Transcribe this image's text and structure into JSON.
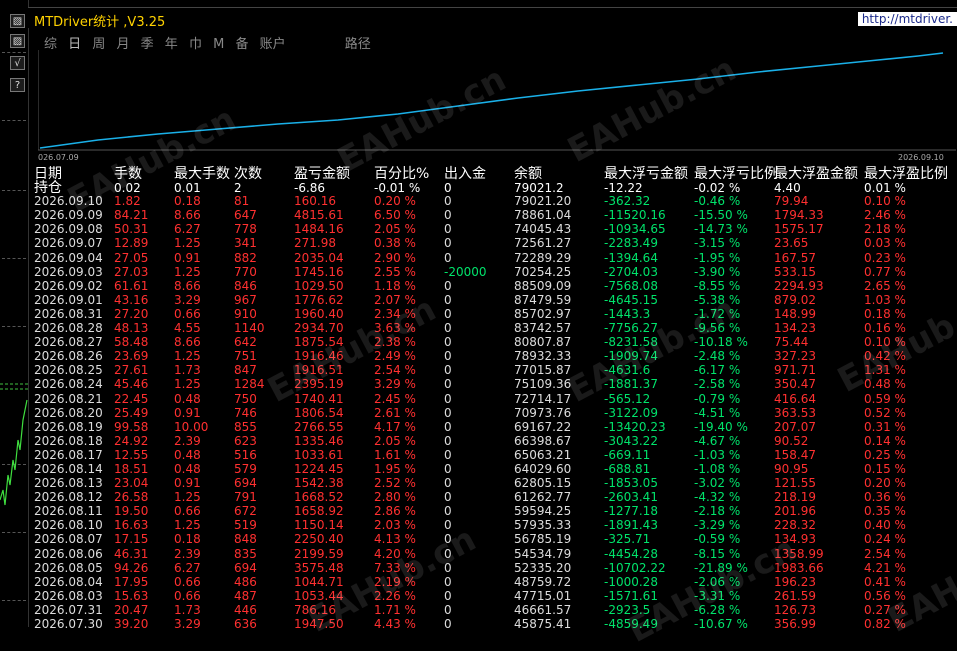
{
  "app": {
    "title": "MTDriver统计 ,V3.25",
    "url": "http://mtdriver."
  },
  "toolbar": [
    "▧",
    "▨",
    "√",
    "?"
  ],
  "tabs": [
    "综",
    "日",
    "周",
    "月",
    "季",
    "年",
    "巾",
    "M",
    "备",
    "账户",
    "路径"
  ],
  "chart": {
    "start_label": "026.07.09",
    "end_label": "2026.09.10",
    "line_color": "#1ab0e8"
  },
  "watermark": "EAHub.cn",
  "columns": [
    "日期",
    "手数",
    "最大手数",
    "次数",
    "盈亏金额",
    "百分比%",
    "出入金",
    "余额",
    "最大浮亏金额",
    "最大浮亏比例",
    "最大浮盈金额",
    "最大浮盈比例"
  ],
  "holding": {
    "date": "持仓",
    "lots": "0.02",
    "max_lots": "0.01",
    "count": "2",
    "pnl": "-6.86",
    "pct": "-0.01 %",
    "flow": "0",
    "balance": "79021.2",
    "max_loss": "-12.22",
    "max_loss_pct": "-0.02 %",
    "max_gain": "4.40",
    "max_gain_pct": "0.01 %"
  },
  "rows": [
    [
      "2026.09.10",
      "1.82",
      "0.18",
      "81",
      "160.16",
      "0.20 %",
      "0",
      "79021.20",
      "-362.32",
      "-0.46 %",
      "79.94",
      "0.10 %"
    ],
    [
      "2026.09.09",
      "84.21",
      "8.66",
      "647",
      "4815.61",
      "6.50 %",
      "0",
      "78861.04",
      "-11520.16",
      "-15.50 %",
      "1794.33",
      "2.46 %"
    ],
    [
      "2026.09.08",
      "50.31",
      "6.27",
      "778",
      "1484.16",
      "2.05 %",
      "0",
      "74045.43",
      "-10934.65",
      "-14.73 %",
      "1575.17",
      "2.18 %"
    ],
    [
      "2026.09.07",
      "12.89",
      "1.25",
      "341",
      "271.98",
      "0.38 %",
      "0",
      "72561.27",
      "-2283.49",
      "-3.15 %",
      "23.65",
      "0.03 %"
    ],
    [
      "2026.09.04",
      "27.05",
      "0.91",
      "882",
      "2035.04",
      "2.90 %",
      "0",
      "72289.29",
      "-1394.64",
      "-1.95 %",
      "167.57",
      "0.23 %"
    ],
    [
      "2026.09.03",
      "27.03",
      "1.25",
      "770",
      "1745.16",
      "2.55 %",
      "-20000",
      "70254.25",
      "-2704.03",
      "-3.90 %",
      "533.15",
      "0.77 %"
    ],
    [
      "2026.09.02",
      "61.61",
      "8.66",
      "846",
      "1029.50",
      "1.18 %",
      "0",
      "88509.09",
      "-7568.08",
      "-8.55 %",
      "2294.93",
      "2.65 %"
    ],
    [
      "2026.09.01",
      "43.16",
      "3.29",
      "967",
      "1776.62",
      "2.07 %",
      "0",
      "87479.59",
      "-4645.15",
      "-5.38 %",
      "879.02",
      "1.03 %"
    ],
    [
      "2026.08.31",
      "27.20",
      "0.66",
      "910",
      "1960.40",
      "2.34 %",
      "0",
      "85702.97",
      "-1443.3",
      "-1.72 %",
      "148.99",
      "0.18 %"
    ],
    [
      "2026.08.28",
      "48.13",
      "4.55",
      "1140",
      "2934.70",
      "3.63 %",
      "0",
      "83742.57",
      "-7756.27",
      "-9.56 %",
      "134.23",
      "0.16 %"
    ],
    [
      "2026.08.27",
      "58.48",
      "8.66",
      "642",
      "1875.54",
      "2.38 %",
      "0",
      "80807.87",
      "-8231.58",
      "-10.18 %",
      "75.44",
      "0.10 %"
    ],
    [
      "2026.08.26",
      "23.69",
      "1.25",
      "751",
      "1916.46",
      "2.49 %",
      "0",
      "78932.33",
      "-1909.74",
      "-2.48 %",
      "327.23",
      "0.42 %"
    ],
    [
      "2026.08.25",
      "27.61",
      "1.73",
      "847",
      "1916.51",
      "2.54 %",
      "0",
      "77015.87",
      "-4631.6",
      "-6.17 %",
      "971.71",
      "1.31 %"
    ],
    [
      "2026.08.24",
      "45.46",
      "1.25",
      "1284",
      "2395.19",
      "3.29 %",
      "0",
      "75109.36",
      "-1881.37",
      "-2.58 %",
      "350.47",
      "0.48 %"
    ],
    [
      "2026.08.21",
      "22.45",
      "0.48",
      "750",
      "1740.41",
      "2.45 %",
      "0",
      "72714.17",
      "-565.12",
      "-0.79 %",
      "416.64",
      "0.59 %"
    ],
    [
      "2026.08.20",
      "25.49",
      "0.91",
      "746",
      "1806.54",
      "2.61 %",
      "0",
      "70973.76",
      "-3122.09",
      "-4.51 %",
      "363.53",
      "0.52 %"
    ],
    [
      "2026.08.19",
      "99.58",
      "10.00",
      "855",
      "2766.55",
      "4.17 %",
      "0",
      "69167.22",
      "-13420.23",
      "-19.40 %",
      "207.07",
      "0.31 %"
    ],
    [
      "2026.08.18",
      "24.92",
      "2.39",
      "623",
      "1335.46",
      "2.05 %",
      "0",
      "66398.67",
      "-3043.22",
      "-4.67 %",
      "90.52",
      "0.14 %"
    ],
    [
      "2026.08.17",
      "12.55",
      "0.48",
      "516",
      "1033.61",
      "1.61 %",
      "0",
      "65063.21",
      "-669.11",
      "-1.03 %",
      "158.47",
      "0.25 %"
    ],
    [
      "2026.08.14",
      "18.51",
      "0.48",
      "579",
      "1224.45",
      "1.95 %",
      "0",
      "64029.60",
      "-688.81",
      "-1.08 %",
      "90.95",
      "0.15 %"
    ],
    [
      "2026.08.13",
      "23.04",
      "0.91",
      "694",
      "1542.38",
      "2.52 %",
      "0",
      "62805.15",
      "-1853.05",
      "-3.02 %",
      "121.55",
      "0.20 %"
    ],
    [
      "2026.08.12",
      "26.58",
      "1.25",
      "791",
      "1668.52",
      "2.80 %",
      "0",
      "61262.77",
      "-2603.41",
      "-4.32 %",
      "218.19",
      "0.36 %"
    ],
    [
      "2026.08.11",
      "19.50",
      "0.66",
      "672",
      "1658.92",
      "2.86 %",
      "0",
      "59594.25",
      "-1277.18",
      "-2.18 %",
      "201.96",
      "0.35 %"
    ],
    [
      "2026.08.10",
      "16.63",
      "1.25",
      "519",
      "1150.14",
      "2.03 %",
      "0",
      "57935.33",
      "-1891.43",
      "-3.29 %",
      "228.32",
      "0.40 %"
    ],
    [
      "2026.08.07",
      "17.15",
      "0.18",
      "848",
      "2250.40",
      "4.13 %",
      "0",
      "56785.19",
      "-325.71",
      "-0.59 %",
      "134.93",
      "0.24 %"
    ],
    [
      "2026.08.06",
      "46.31",
      "2.39",
      "835",
      "2199.59",
      "4.20 %",
      "0",
      "54534.79",
      "-4454.28",
      "-8.15 %",
      "1358.99",
      "2.54 %"
    ],
    [
      "2026.08.05",
      "94.26",
      "6.27",
      "694",
      "3575.48",
      "7.33 %",
      "0",
      "52335.20",
      "-10702.22",
      "-21.89 %",
      "1983.66",
      "4.21 %"
    ],
    [
      "2026.08.04",
      "17.95",
      "0.66",
      "486",
      "1044.71",
      "2.19 %",
      "0",
      "48759.72",
      "-1000.28",
      "-2.06 %",
      "196.23",
      "0.41 %"
    ],
    [
      "2026.08.03",
      "15.63",
      "0.66",
      "487",
      "1053.44",
      "2.26 %",
      "0",
      "47715.01",
      "-1571.61",
      "-3.31 %",
      "261.59",
      "0.56 %"
    ],
    [
      "2026.07.31",
      "20.47",
      "1.73",
      "446",
      "786.16",
      "1.71 %",
      "0",
      "46661.57",
      "-2923.5",
      "-6.28 %",
      "126.73",
      "0.27 %"
    ],
    [
      "2026.07.30",
      "39.20",
      "3.29",
      "636",
      "1947.50",
      "4.43 %",
      "0",
      "45875.41",
      "-4859.49",
      "-10.67 %",
      "356.99",
      "0.82 %"
    ]
  ]
}
